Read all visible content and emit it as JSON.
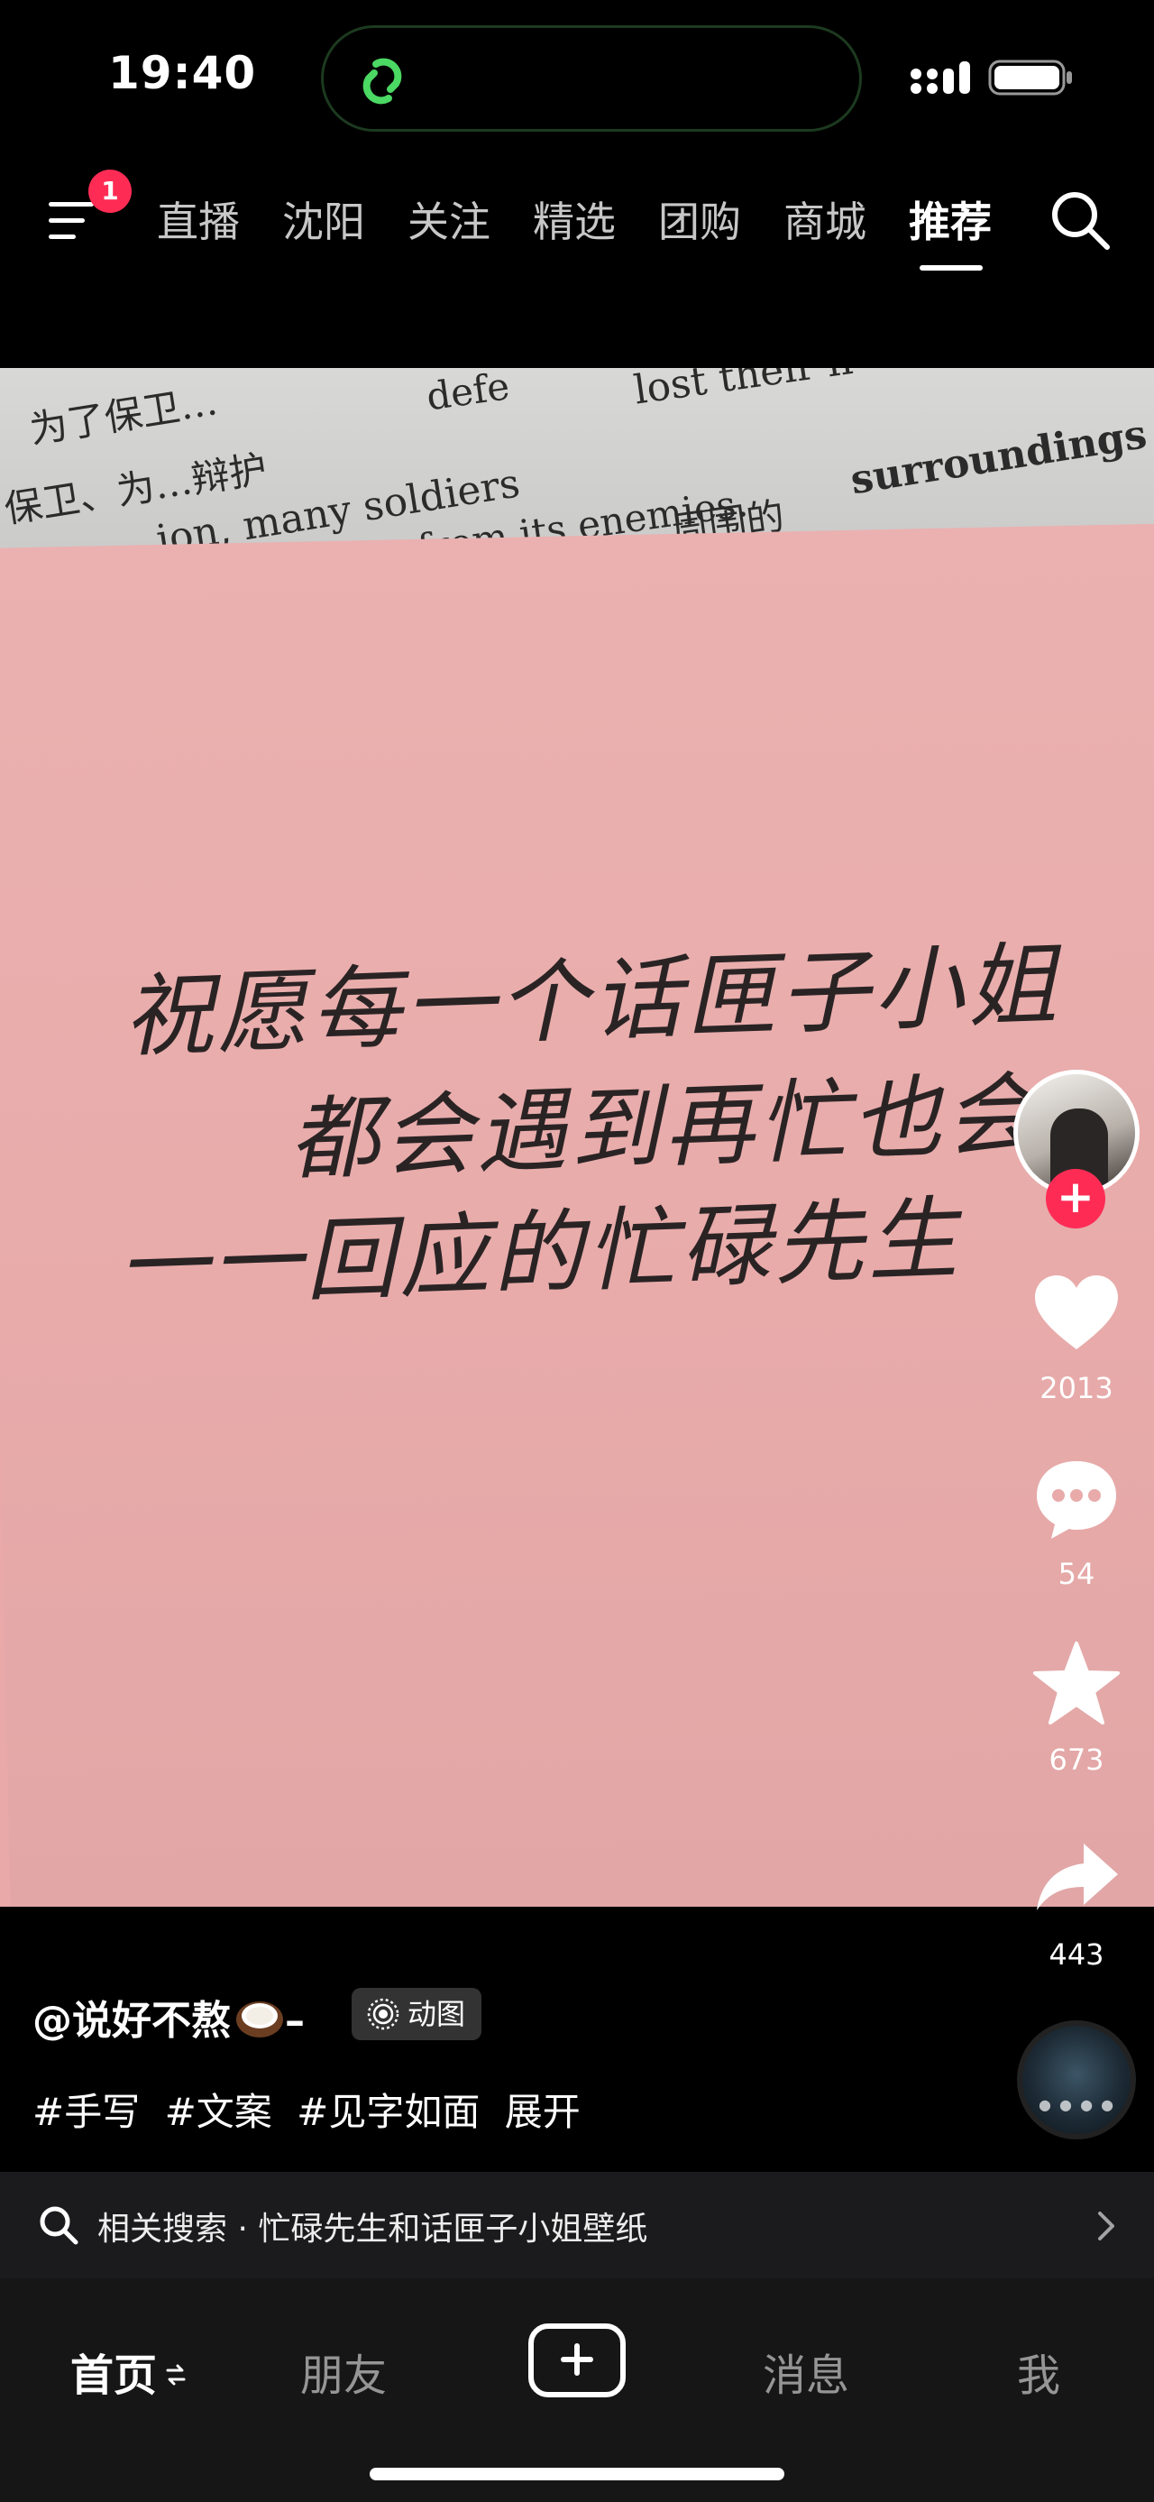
{
  "status_bar": {
    "time": "19:40"
  },
  "top_nav": {
    "menu_badge": "1",
    "tabs": [
      {
        "label": "直播",
        "active": false
      },
      {
        "label": "沈阳",
        "active": false
      },
      {
        "label": "关注",
        "active": false
      },
      {
        "label": "精选",
        "active": false
      },
      {
        "label": "团购",
        "active": false
      },
      {
        "label": "商城",
        "active": false
      },
      {
        "label": "推荐",
        "active": true
      }
    ],
    "icons": [
      "menu-icon",
      "search-icon"
    ]
  },
  "video": {
    "book_text": [
      "为了保卫…",
      "defe",
      "lost their li",
      "保卫、为…辩护",
      "ion, many soldiers",
      "from its enemies.",
      "周围的",
      "surroundings"
    ],
    "handwriting": [
      "祝愿每一个话匣子小姐",
      "都会遇到再忙也会",
      "一一回应的忙碌先生"
    ]
  },
  "actions": {
    "likes": "2013",
    "comments": "54",
    "favorites": "673",
    "shares": "443",
    "icons": [
      "heart-icon",
      "comment-icon",
      "star-icon",
      "share-icon",
      "follow-plus-icon"
    ]
  },
  "caption": {
    "author": "@说好不熬",
    "author_suffix": "–",
    "tag": "动图",
    "hashtags": [
      "#手写",
      "#文案",
      "#见字如面"
    ],
    "expand": "展开"
  },
  "related_search": {
    "prefix": "相关搜索 · ",
    "query": "忙碌先生和话匣子小姐壁纸"
  },
  "bottom_tabs": {
    "home": "首页",
    "friends": "朋友",
    "messages": "消息",
    "me": "我"
  },
  "colors": {
    "accent": "#fe2c55",
    "card_pink": "#e8abaa",
    "background": "#000000"
  }
}
